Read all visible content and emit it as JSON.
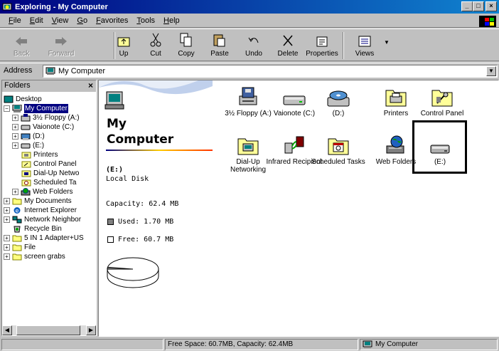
{
  "window": {
    "title": "Exploring - My Computer"
  },
  "menu": {
    "items": [
      {
        "accel": "F",
        "rest": "ile"
      },
      {
        "accel": "E",
        "rest": "dit"
      },
      {
        "accel": "V",
        "rest": "iew"
      },
      {
        "accel": "G",
        "rest": "o"
      },
      {
        "accel": "F",
        "rest": "avorites"
      },
      {
        "accel": "T",
        "rest": "ools"
      },
      {
        "accel": "H",
        "rest": "elp"
      }
    ]
  },
  "toolbar": {
    "back": "Back",
    "forward": "Forward",
    "up": "Up",
    "cut": "Cut",
    "copy": "Copy",
    "paste": "Paste",
    "undo": "Undo",
    "delete": "Delete",
    "properties": "Properties",
    "views": "Views"
  },
  "address": {
    "label": "Address",
    "value": "My Computer"
  },
  "folders": {
    "header": "Folders",
    "close": "×",
    "tree": [
      {
        "label": "Desktop"
      },
      {
        "label": "My Computer"
      },
      {
        "label": "3½ Floppy (A:)"
      },
      {
        "label": "Vaionote (C:)"
      },
      {
        "label": "(D:)"
      },
      {
        "label": "(E:)"
      },
      {
        "label": "Printers"
      },
      {
        "label": "Control Panel"
      },
      {
        "label": "Dial-Up Netwo"
      },
      {
        "label": "Scheduled Ta"
      },
      {
        "label": "Web Folders"
      },
      {
        "label": "My Documents"
      },
      {
        "label": "Internet Explorer"
      },
      {
        "label": "Network Neighbor"
      },
      {
        "label": "Recycle Bin"
      },
      {
        "label": "5 IN 1 Adapter+US"
      },
      {
        "label": "File"
      },
      {
        "label": "screen grabs"
      }
    ]
  },
  "info": {
    "title_line1": "My",
    "title_line2": "Computer",
    "drive_name": "(E:)",
    "drive_type": "Local Disk",
    "capacity": "Capacity: 62.4 MB",
    "used": "Used: 1.70 MB",
    "free": "Free: 60.7 MB",
    "used_fraction": 0.027,
    "colors": {
      "used": "#808080",
      "free": "#ffffff"
    }
  },
  "icons": [
    {
      "label": "3½ Floppy (A:)",
      "icon": "floppy-drive-icon"
    },
    {
      "label": "Vaionote (C:)",
      "icon": "hard-drive-icon"
    },
    {
      "label": "(D:)",
      "icon": "cd-drive-icon"
    },
    {
      "label": "Printers",
      "icon": "printers-folder-icon"
    },
    {
      "label": "Control Panel",
      "icon": "control-panel-icon"
    },
    {
      "label": "Dial-Up Networking",
      "icon": "dialup-networking-icon"
    },
    {
      "label": "Infrared Recipient",
      "icon": "infrared-icon"
    },
    {
      "label": "Scheduled Tasks",
      "icon": "scheduled-tasks-icon"
    },
    {
      "label": "Web Folders",
      "icon": "web-folders-icon"
    },
    {
      "label": "(E:)",
      "icon": "removable-drive-icon"
    }
  ],
  "status": {
    "left": "",
    "middle": "Free Space: 60.7MB,  Capacity: 62.4MB",
    "right": "My Computer"
  }
}
